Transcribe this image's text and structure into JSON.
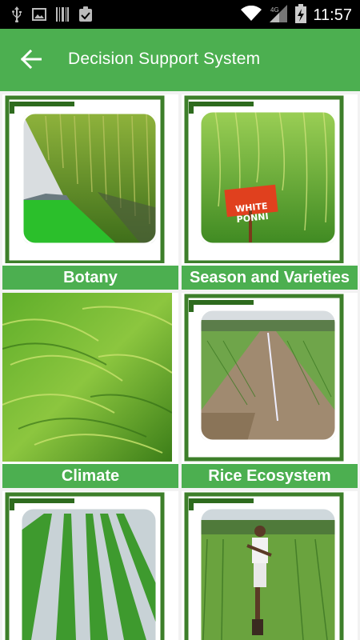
{
  "status_bar": {
    "time": "11:57",
    "icons": [
      "usb-icon",
      "image-icon",
      "barcode-icon",
      "clipboard-check-icon",
      "wifi-icon",
      "signal-icon",
      "battery-charging-icon"
    ]
  },
  "app_bar": {
    "title": "Decision Support System",
    "back_icon": "arrow-back-icon"
  },
  "tiles": [
    {
      "label": "Botany"
    },
    {
      "label": "Season and Varieties",
      "sign_text": "WHITE PONNI"
    },
    {
      "label": "Climate"
    },
    {
      "label": "Rice Ecosystem"
    },
    {
      "label": ""
    },
    {
      "label": ""
    }
  ],
  "colors": {
    "primary": "#4caf50",
    "frame_dark": "#2e6b1e",
    "status_bar": "#000000"
  }
}
